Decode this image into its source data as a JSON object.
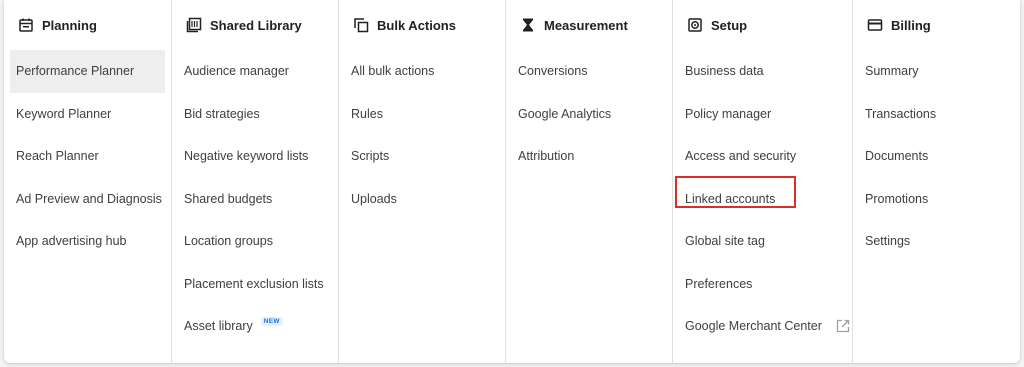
{
  "columns": [
    {
      "title": "Planning",
      "icon": "calendar-icon",
      "items": [
        {
          "label": "Performance Planner",
          "active": true
        },
        {
          "label": "Keyword Planner"
        },
        {
          "label": "Reach Planner"
        },
        {
          "label": "Ad Preview and Diagnosis"
        },
        {
          "label": "App advertising hub"
        }
      ]
    },
    {
      "title": "Shared Library",
      "icon": "library-icon",
      "items": [
        {
          "label": "Audience manager"
        },
        {
          "label": "Bid strategies"
        },
        {
          "label": "Negative keyword lists"
        },
        {
          "label": "Shared budgets"
        },
        {
          "label": "Location groups"
        },
        {
          "label": "Placement exclusion lists"
        },
        {
          "label": "Asset library",
          "badge": "NEW"
        }
      ]
    },
    {
      "title": "Bulk Actions",
      "icon": "copy-icon",
      "items": [
        {
          "label": "All bulk actions"
        },
        {
          "label": "Rules"
        },
        {
          "label": "Scripts"
        },
        {
          "label": "Uploads"
        }
      ]
    },
    {
      "title": "Measurement",
      "icon": "hourglass-icon",
      "items": [
        {
          "label": "Conversions"
        },
        {
          "label": "Google Analytics"
        },
        {
          "label": "Attribution"
        }
      ]
    },
    {
      "title": "Setup",
      "icon": "settings-icon",
      "items": [
        {
          "label": "Business data"
        },
        {
          "label": "Policy manager"
        },
        {
          "label": "Access and security"
        },
        {
          "label": "Linked accounts",
          "highlighted": true
        },
        {
          "label": "Global site tag"
        },
        {
          "label": "Preferences"
        },
        {
          "label": "Google Merchant Center",
          "external": true
        }
      ]
    },
    {
      "title": "Billing",
      "icon": "credit-card-icon",
      "items": [
        {
          "label": "Summary"
        },
        {
          "label": "Transactions"
        },
        {
          "label": "Documents"
        },
        {
          "label": "Promotions"
        },
        {
          "label": "Settings"
        }
      ]
    }
  ],
  "colors": {
    "highlight_border": "#d93025",
    "active_bg": "#eeeeee",
    "badge_text": "#1a73e8",
    "badge_bg": "#e8f0fe"
  }
}
